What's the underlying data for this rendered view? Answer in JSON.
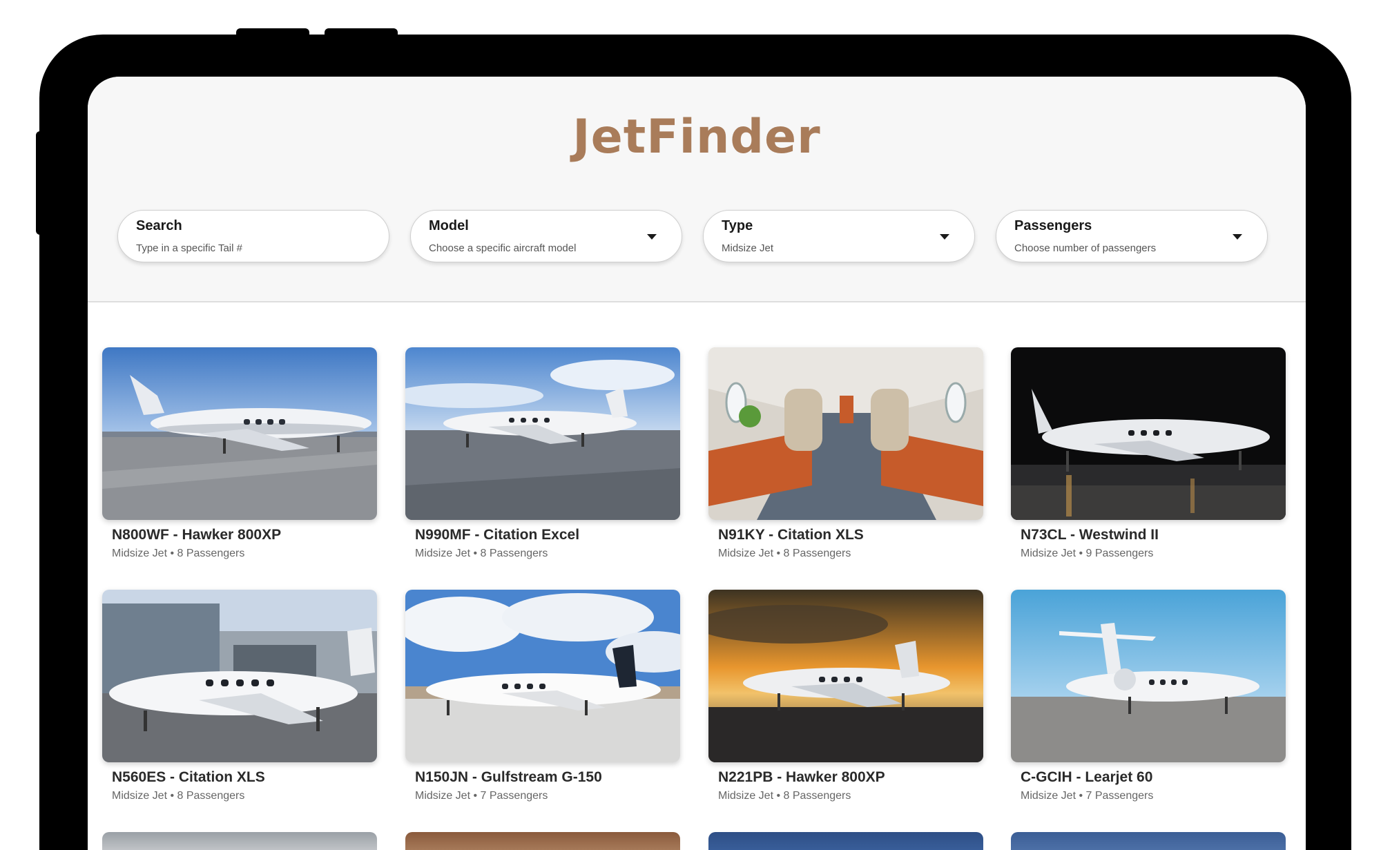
{
  "app": {
    "logo": "JetFinder",
    "brand_color": "#a97c5a"
  },
  "filters": [
    {
      "label": "Search",
      "value": "Type in a specific Tail #",
      "dropdown": false
    },
    {
      "label": "Model",
      "value": "Choose a specific aircraft model",
      "dropdown": true
    },
    {
      "label": "Type",
      "value": "Midsize Jet",
      "dropdown": true
    },
    {
      "label": "Passengers",
      "value": "Choose number of passengers",
      "dropdown": true
    }
  ],
  "listings": [
    {
      "title": "N800WF - Hawker 800XP",
      "subtitle": "Midsize Jet • 8 Passengers",
      "scene": "runway"
    },
    {
      "title": "N990MF - Citation Excel",
      "subtitle": "Midsize Jet • 8 Passengers",
      "scene": "cloudy-tarmac"
    },
    {
      "title": "N91KY - Citation XLS",
      "subtitle": "Midsize Jet • 8 Passengers",
      "scene": "cabin-interior"
    },
    {
      "title": "N73CL - Westwind II",
      "subtitle": "Midsize Jet • 9 Passengers",
      "scene": "night-hangar"
    },
    {
      "title": "N560ES - Citation XLS",
      "subtitle": "Midsize Jet • 8 Passengers",
      "scene": "hangar"
    },
    {
      "title": "N150JN - Gulfstream G-150",
      "subtitle": "Midsize Jet • 7 Passengers",
      "scene": "bright-clouds"
    },
    {
      "title": "N221PB - Hawker 800XP",
      "subtitle": "Midsize Jet • 8 Passengers",
      "scene": "sunset"
    },
    {
      "title": "C-GCIH - Learjet 60",
      "subtitle": "Midsize Jet • 7 Passengers",
      "scene": "clear-sky"
    }
  ]
}
